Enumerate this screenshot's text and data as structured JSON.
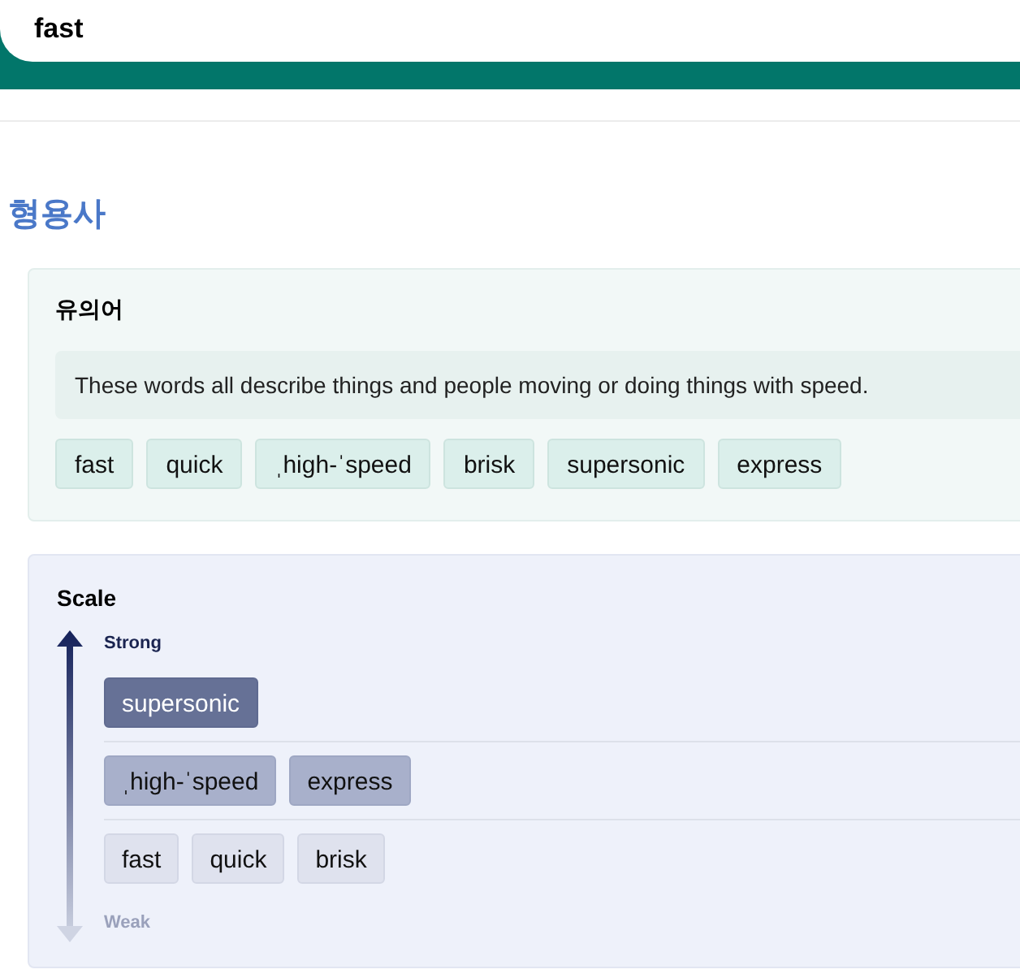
{
  "search": {
    "value": "fast"
  },
  "part_of_speech": "형용사",
  "synonyms": {
    "title": "유의어",
    "note": "These words all describe things and people moving or doing things with speed.",
    "words": [
      "fast",
      "quick",
      "ˌhigh-ˈspeed",
      "brisk",
      "supersonic",
      "express"
    ]
  },
  "scale": {
    "title": "Scale",
    "top_label": "Strong",
    "bottom_label": "Weak",
    "rows": [
      {
        "kind": "strong",
        "words": [
          "supersonic"
        ]
      },
      {
        "kind": "medium",
        "words": [
          "ˌhigh-ˈspeed",
          "express"
        ]
      },
      {
        "kind": "weak",
        "words": [
          "fast",
          "quick",
          "brisk"
        ]
      }
    ]
  }
}
